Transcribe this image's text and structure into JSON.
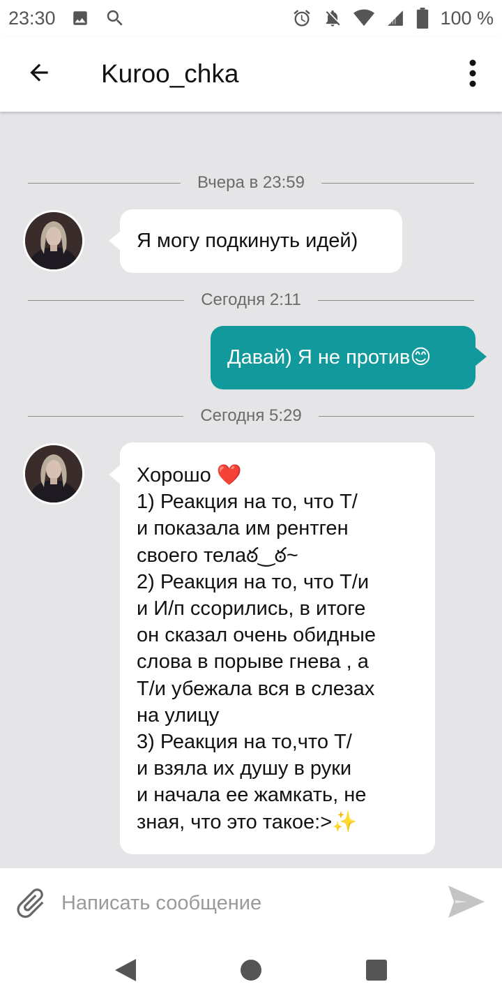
{
  "status_bar": {
    "time": "23:30",
    "battery": "100 %",
    "icons": [
      "image-icon",
      "search-icon",
      "alarm-icon",
      "mute-icon",
      "wifi-icon",
      "signal-icon",
      "battery-icon"
    ]
  },
  "header": {
    "title": "Kuroo_chka",
    "icons": [
      "back-arrow-icon",
      "more-vert-icon"
    ]
  },
  "messages": [
    {
      "type": "date",
      "text": "Вчера в 23:59"
    },
    {
      "type": "incoming",
      "text": "Я могу подкинуть идей)"
    },
    {
      "type": "date",
      "text": "Сегодня 2:11"
    },
    {
      "type": "outgoing",
      "text": "Давай) Я не против😊"
    },
    {
      "type": "date",
      "text": "Сегодня 5:29"
    },
    {
      "type": "incoming",
      "text": "Хорошо ❤️\n1) Реакция на то, что Т/\nи показала им рентген\nсвоего телаఠ‿ఠ~\n2) Реакция на то, что Т/и\nи И/п ссорились, в итоге\nон сказал очень обидные\nслова в порыве гнева , а\nТ/и убежала вся в слезах\nна улицу\n3) Реакция на то,что Т/\nи взяла их душу в руки\nи начала ее жамкать, не\nзная, что это такое:>✨"
    }
  ],
  "composer": {
    "placeholder": "Написать сообщение",
    "value": "",
    "icons": [
      "paperclip-icon",
      "send-icon"
    ]
  },
  "colors": {
    "outgoing_bubble": "#12999c",
    "incoming_bubble": "#ffffff",
    "chat_background": "#e5e5e8",
    "bar_background": "#ffffff"
  },
  "nav_bar": {
    "icons": [
      "back-triangle-icon",
      "home-circle-icon",
      "recents-square-icon"
    ]
  }
}
